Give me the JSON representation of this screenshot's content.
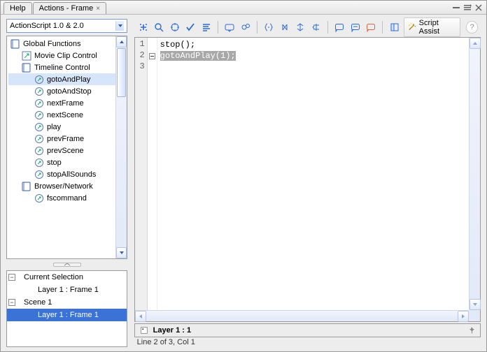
{
  "tabs": {
    "help": "Help",
    "actions": "Actions - Frame"
  },
  "version_selector": "ActionScript 1.0 & 2.0",
  "tree": {
    "root": "Global Functions",
    "items": [
      {
        "label": "Movie Clip Control",
        "type": "folder"
      },
      {
        "label": "Timeline Control",
        "type": "folder",
        "expanded": true
      },
      {
        "label": "gotoAndPlay",
        "type": "fn",
        "selected": true
      },
      {
        "label": "gotoAndStop",
        "type": "fn"
      },
      {
        "label": "nextFrame",
        "type": "fn"
      },
      {
        "label": "nextScene",
        "type": "fn"
      },
      {
        "label": "play",
        "type": "fn"
      },
      {
        "label": "prevFrame",
        "type": "fn"
      },
      {
        "label": "prevScene",
        "type": "fn"
      },
      {
        "label": "stop",
        "type": "fn"
      },
      {
        "label": "stopAllSounds",
        "type": "fn"
      },
      {
        "label": "Browser/Network",
        "type": "folder"
      },
      {
        "label": "fscommand",
        "type": "fn"
      }
    ]
  },
  "selection_tree": {
    "current": "Current Selection",
    "current_item": "Layer 1 : Frame 1",
    "scene": "Scene 1",
    "scene_item": "Layer 1 : Frame 1"
  },
  "toolbar": {
    "script_assist": "Script Assist"
  },
  "code": {
    "lines": [
      "1",
      "2",
      "3"
    ],
    "line1": "stop();",
    "line2": "gotoAndPlay(1);"
  },
  "status": {
    "layer": "Layer 1 : 1",
    "position": "Line 2 of 3, Col 1"
  }
}
